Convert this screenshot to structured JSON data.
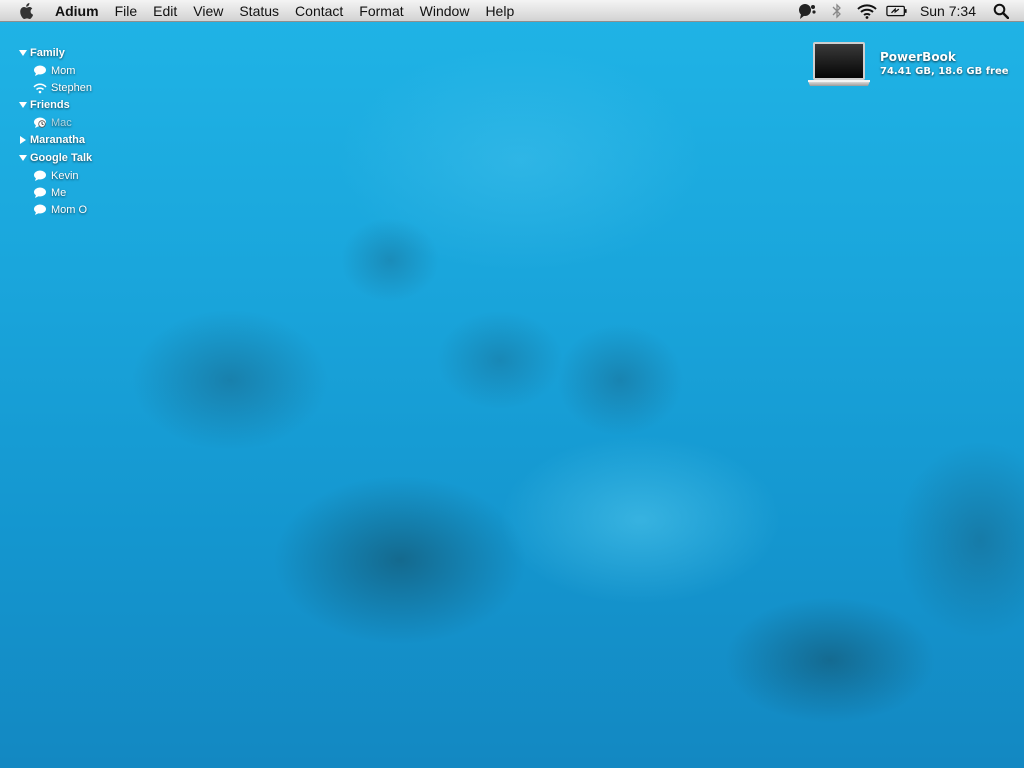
{
  "menubar": {
    "app_name": "Adium",
    "items": [
      "File",
      "Edit",
      "View",
      "Status",
      "Contact",
      "Format",
      "Window",
      "Help"
    ],
    "clock": "Sun 7:34",
    "icons": [
      "apple-icon",
      "adium-status-icon",
      "bluetooth-icon",
      "wifi-icon",
      "battery-icon",
      "spotlight-icon"
    ]
  },
  "contact_list": {
    "groups": [
      {
        "name": "Family",
        "expanded": true,
        "contacts": [
          {
            "name": "Mom",
            "icon": "speech-bubble-icon"
          },
          {
            "name": "Stephen",
            "icon": "wifi-icon"
          }
        ]
      },
      {
        "name": "Friends",
        "expanded": true,
        "contacts": [
          {
            "name": "Mac",
            "icon": "idle-clock-icon"
          }
        ]
      },
      {
        "name": "Maranatha",
        "expanded": false,
        "contacts": []
      },
      {
        "name": "Google Talk",
        "expanded": true,
        "contacts": [
          {
            "name": "Kevin",
            "icon": "speech-bubble-icon"
          },
          {
            "name": "Me",
            "icon": "speech-bubble-icon"
          },
          {
            "name": "Mom O",
            "icon": "speech-bubble-icon"
          }
        ]
      }
    ]
  },
  "desktop": {
    "drive": {
      "name": "PowerBook",
      "info": "74.41 GB, 18.6 GB free",
      "icon": "laptop-drive-icon"
    }
  }
}
